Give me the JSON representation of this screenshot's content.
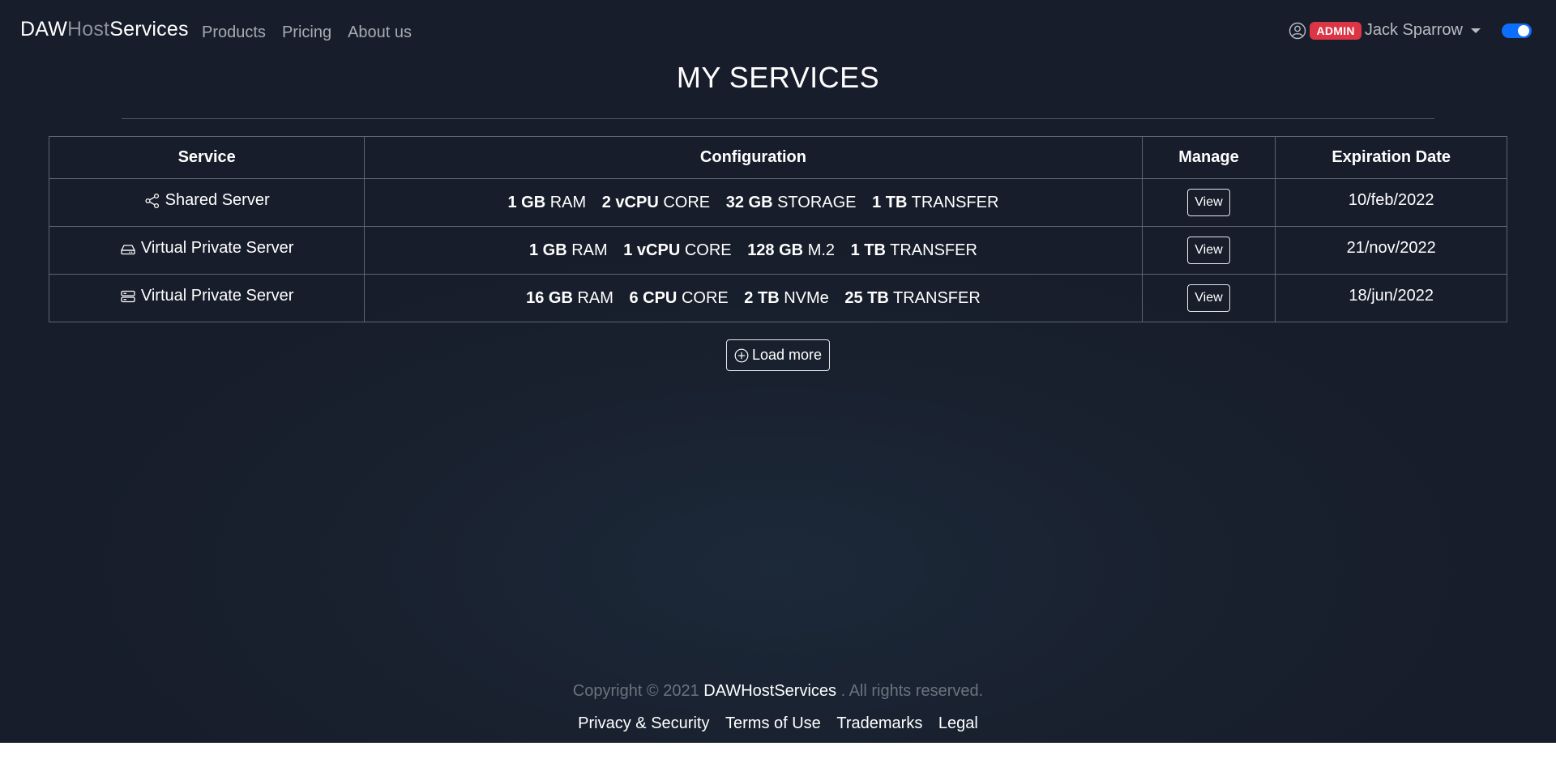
{
  "brand": {
    "part1": "DAW",
    "part2": "Host",
    "part3": "Services"
  },
  "nav": {
    "products": "Products",
    "pricing": "Pricing",
    "about": "About us"
  },
  "user": {
    "badge": "ADMIN",
    "name": "Jack Sparrow",
    "theme_toggle_on": true
  },
  "page": {
    "title": "MY SERVICES"
  },
  "table": {
    "headers": {
      "service": "Service",
      "configuration": "Configuration",
      "manage": "Manage",
      "expiration": "Expiration Date"
    },
    "rows": [
      {
        "icon": "share-icon",
        "service": "Shared Server",
        "config": [
          {
            "value": "1 GB",
            "unit": "RAM"
          },
          {
            "value": "2 vCPU",
            "unit": "CORE"
          },
          {
            "value": "32 GB",
            "unit": "STORAGE"
          },
          {
            "value": "1 TB",
            "unit": "TRANSFER"
          }
        ],
        "action": "View",
        "expiration": "10/feb/2022"
      },
      {
        "icon": "hdd-icon",
        "service": "Virtual Private Server",
        "config": [
          {
            "value": "1 GB",
            "unit": "RAM"
          },
          {
            "value": "1 vCPU",
            "unit": "CORE"
          },
          {
            "value": "128 GB",
            "unit": "M.2"
          },
          {
            "value": "1 TB",
            "unit": "TRANSFER"
          }
        ],
        "action": "View",
        "expiration": "21/nov/2022"
      },
      {
        "icon": "server-stack-icon",
        "service": "Virtual Private Server",
        "config": [
          {
            "value": "16 GB",
            "unit": "RAM"
          },
          {
            "value": "6 CPU",
            "unit": "CORE"
          },
          {
            "value": "2 TB",
            "unit": "NVMe"
          },
          {
            "value": "25 TB",
            "unit": "TRANSFER"
          }
        ],
        "action": "View",
        "expiration": "18/jun/2022"
      }
    ]
  },
  "load_more": "Load more",
  "footer": {
    "copyright_prefix": "Copyright © 2021",
    "copyright_brand": "DAWHostServices",
    "copyright_suffix": ". All rights reserved.",
    "links": [
      "Privacy & Security",
      "Terms of Use",
      "Trademarks",
      "Legal"
    ]
  },
  "colors": {
    "accent": "#0d6efd",
    "badge": "#dc3545",
    "background": "#19212f"
  }
}
